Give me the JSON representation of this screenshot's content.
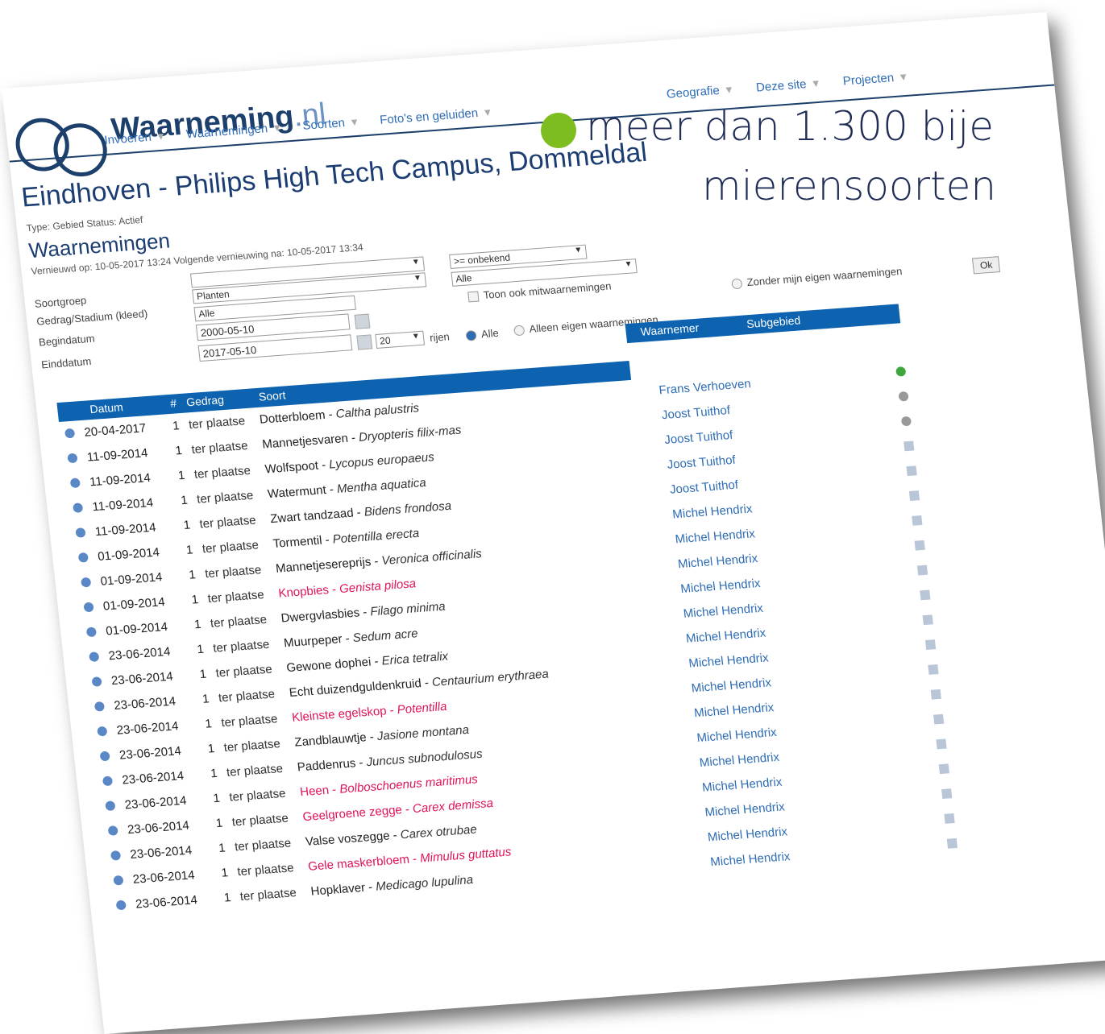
{
  "site": {
    "logo_main": "Waarneming",
    "logo_tld": ".nl"
  },
  "menu": {
    "row1": [
      "Invoeren",
      "Waarnemingen",
      "Soorten",
      "Foto's en geluiden"
    ],
    "row2": [
      "Geografie",
      "Deze site",
      "Projecten"
    ]
  },
  "page": {
    "title": "Eindhoven - Philips High Tech Campus, Dommeldal",
    "meta": "Type: Gebied  Status: Actief",
    "section": "Waarnemingen",
    "edit_info": "Vernieuwd op: 10-05-2017 13:24 Volgende vernieuwing na: 10-05-2017 13:34"
  },
  "form": {
    "labels": [
      "Soortgroep",
      "Gedrag/Stadium (kleed)",
      "Begindatum",
      "Einddatum"
    ],
    "soortgroep": "Planten",
    "gedrag": "Alle",
    "begindatum": "2000-05-10",
    "einddatum": "2017-05-10",
    "status_select": ">= onbekend",
    "second_select": "Alle",
    "rows_select": "20",
    "rows_suffix": "rijen",
    "toon_ook": "Toon ook mitwaarnemingen",
    "alle": "Alle",
    "alleen_eigen": "Alleen eigen waarnemingen",
    "zonder_eigen": "Zonder mijn eigen waarnemingen",
    "ok": "Ok"
  },
  "table": {
    "headers": {
      "datum": "Datum",
      "hash": "#",
      "gedrag": "Gedrag",
      "soort": "Soort",
      "waarnemer": "Waarnemer",
      "subgebied": "Subgebied"
    },
    "rows": [
      {
        "date": "20-04-2017",
        "n": "1",
        "ged": "ter plaatse",
        "soort": "Dotterbloem - ",
        "latin": "Caltha palustris",
        "obs": "Frans Verhoeven",
        "red": false
      },
      {
        "date": "11-09-2014",
        "n": "1",
        "ged": "ter plaatse",
        "soort": "Mannetjesvaren - ",
        "latin": "Dryopteris filix-mas",
        "obs": "Joost Tuithof",
        "red": false
      },
      {
        "date": "11-09-2014",
        "n": "1",
        "ged": "ter plaatse",
        "soort": "Wolfspoot - ",
        "latin": "Lycopus europaeus",
        "obs": "Joost Tuithof",
        "red": false
      },
      {
        "date": "11-09-2014",
        "n": "1",
        "ged": "ter plaatse",
        "soort": "Watermunt - ",
        "latin": "Mentha aquatica",
        "obs": "Joost Tuithof",
        "red": false
      },
      {
        "date": "11-09-2014",
        "n": "1",
        "ged": "ter plaatse",
        "soort": "Zwart tandzaad - ",
        "latin": "Bidens frondosa",
        "obs": "Joost Tuithof",
        "red": false
      },
      {
        "date": "01-09-2014",
        "n": "1",
        "ged": "ter plaatse",
        "soort": "Tormentil - ",
        "latin": "Potentilla erecta",
        "obs": "Michel Hendrix",
        "red": false
      },
      {
        "date": "01-09-2014",
        "n": "1",
        "ged": "ter plaatse",
        "soort": "Mannetjesereprijs - ",
        "latin": "Veronica officinalis",
        "obs": "Michel Hendrix",
        "red": false
      },
      {
        "date": "01-09-2014",
        "n": "1",
        "ged": "ter plaatse",
        "soort": "Knopbies - ",
        "latin": "Genista pilosa",
        "obs": "Michel Hendrix",
        "red": true
      },
      {
        "date": "01-09-2014",
        "n": "1",
        "ged": "ter plaatse",
        "soort": "Dwergvlasbies - ",
        "latin": "Filago minima",
        "obs": "Michel Hendrix",
        "red": false
      },
      {
        "date": "23-06-2014",
        "n": "1",
        "ged": "ter plaatse",
        "soort": "Muurpeper - ",
        "latin": "Sedum acre",
        "obs": "Michel Hendrix",
        "red": false
      },
      {
        "date": "23-06-2014",
        "n": "1",
        "ged": "ter plaatse",
        "soort": "Gewone dophei - ",
        "latin": "Erica tetralix",
        "obs": "Michel Hendrix",
        "red": false
      },
      {
        "date": "23-06-2014",
        "n": "1",
        "ged": "ter plaatse",
        "soort": "Echt duizendguldenkruid - ",
        "latin": "Centaurium erythraea",
        "obs": "Michel Hendrix",
        "red": false
      },
      {
        "date": "23-06-2014",
        "n": "1",
        "ged": "ter plaatse",
        "soort": "Kleinste egelskop - ",
        "latin": "Potentilla",
        "obs": "Michel Hendrix",
        "red": true
      },
      {
        "date": "23-06-2014",
        "n": "1",
        "ged": "ter plaatse",
        "soort": "Zandblauwtje - ",
        "latin": "Jasione montana",
        "obs": "Michel Hendrix",
        "red": false
      },
      {
        "date": "23-06-2014",
        "n": "1",
        "ged": "ter plaatse",
        "soort": "Paddenrus - ",
        "latin": "Juncus subnodulosus",
        "obs": "Michel Hendrix",
        "red": false
      },
      {
        "date": "23-06-2014",
        "n": "1",
        "ged": "ter plaatse",
        "soort": "Heen - ",
        "latin": "Bolboschoenus maritimus",
        "obs": "Michel Hendrix",
        "red": true
      },
      {
        "date": "23-06-2014",
        "n": "1",
        "ged": "ter plaatse",
        "soort": "Geelgroene zegge - ",
        "latin": "Carex demissa",
        "obs": "Michel Hendrix",
        "red": true
      },
      {
        "date": "23-06-2014",
        "n": "1",
        "ged": "ter plaatse",
        "soort": "Valse voszegge - ",
        "latin": "Carex otrubae",
        "obs": "Michel Hendrix",
        "red": false
      },
      {
        "date": "23-06-2014",
        "n": "1",
        "ged": "ter plaatse",
        "soort": "Gele maskerbloem - ",
        "latin": "Mimulus guttatus",
        "obs": "Michel Hendrix",
        "red": true
      },
      {
        "date": "23-06-2014",
        "n": "1",
        "ged": "ter plaatse",
        "soort": "Hopklaver - ",
        "latin": "Medicago lupulina",
        "obs": "Michel Hendrix",
        "red": false
      }
    ]
  },
  "overlay": {
    "line1": "meer dan 1.300 bije",
    "line2": "mierensoorten"
  },
  "colors": {
    "accent": "#0d63b0",
    "dot": "#7dbd1f",
    "warning_text": "#e0145a"
  }
}
